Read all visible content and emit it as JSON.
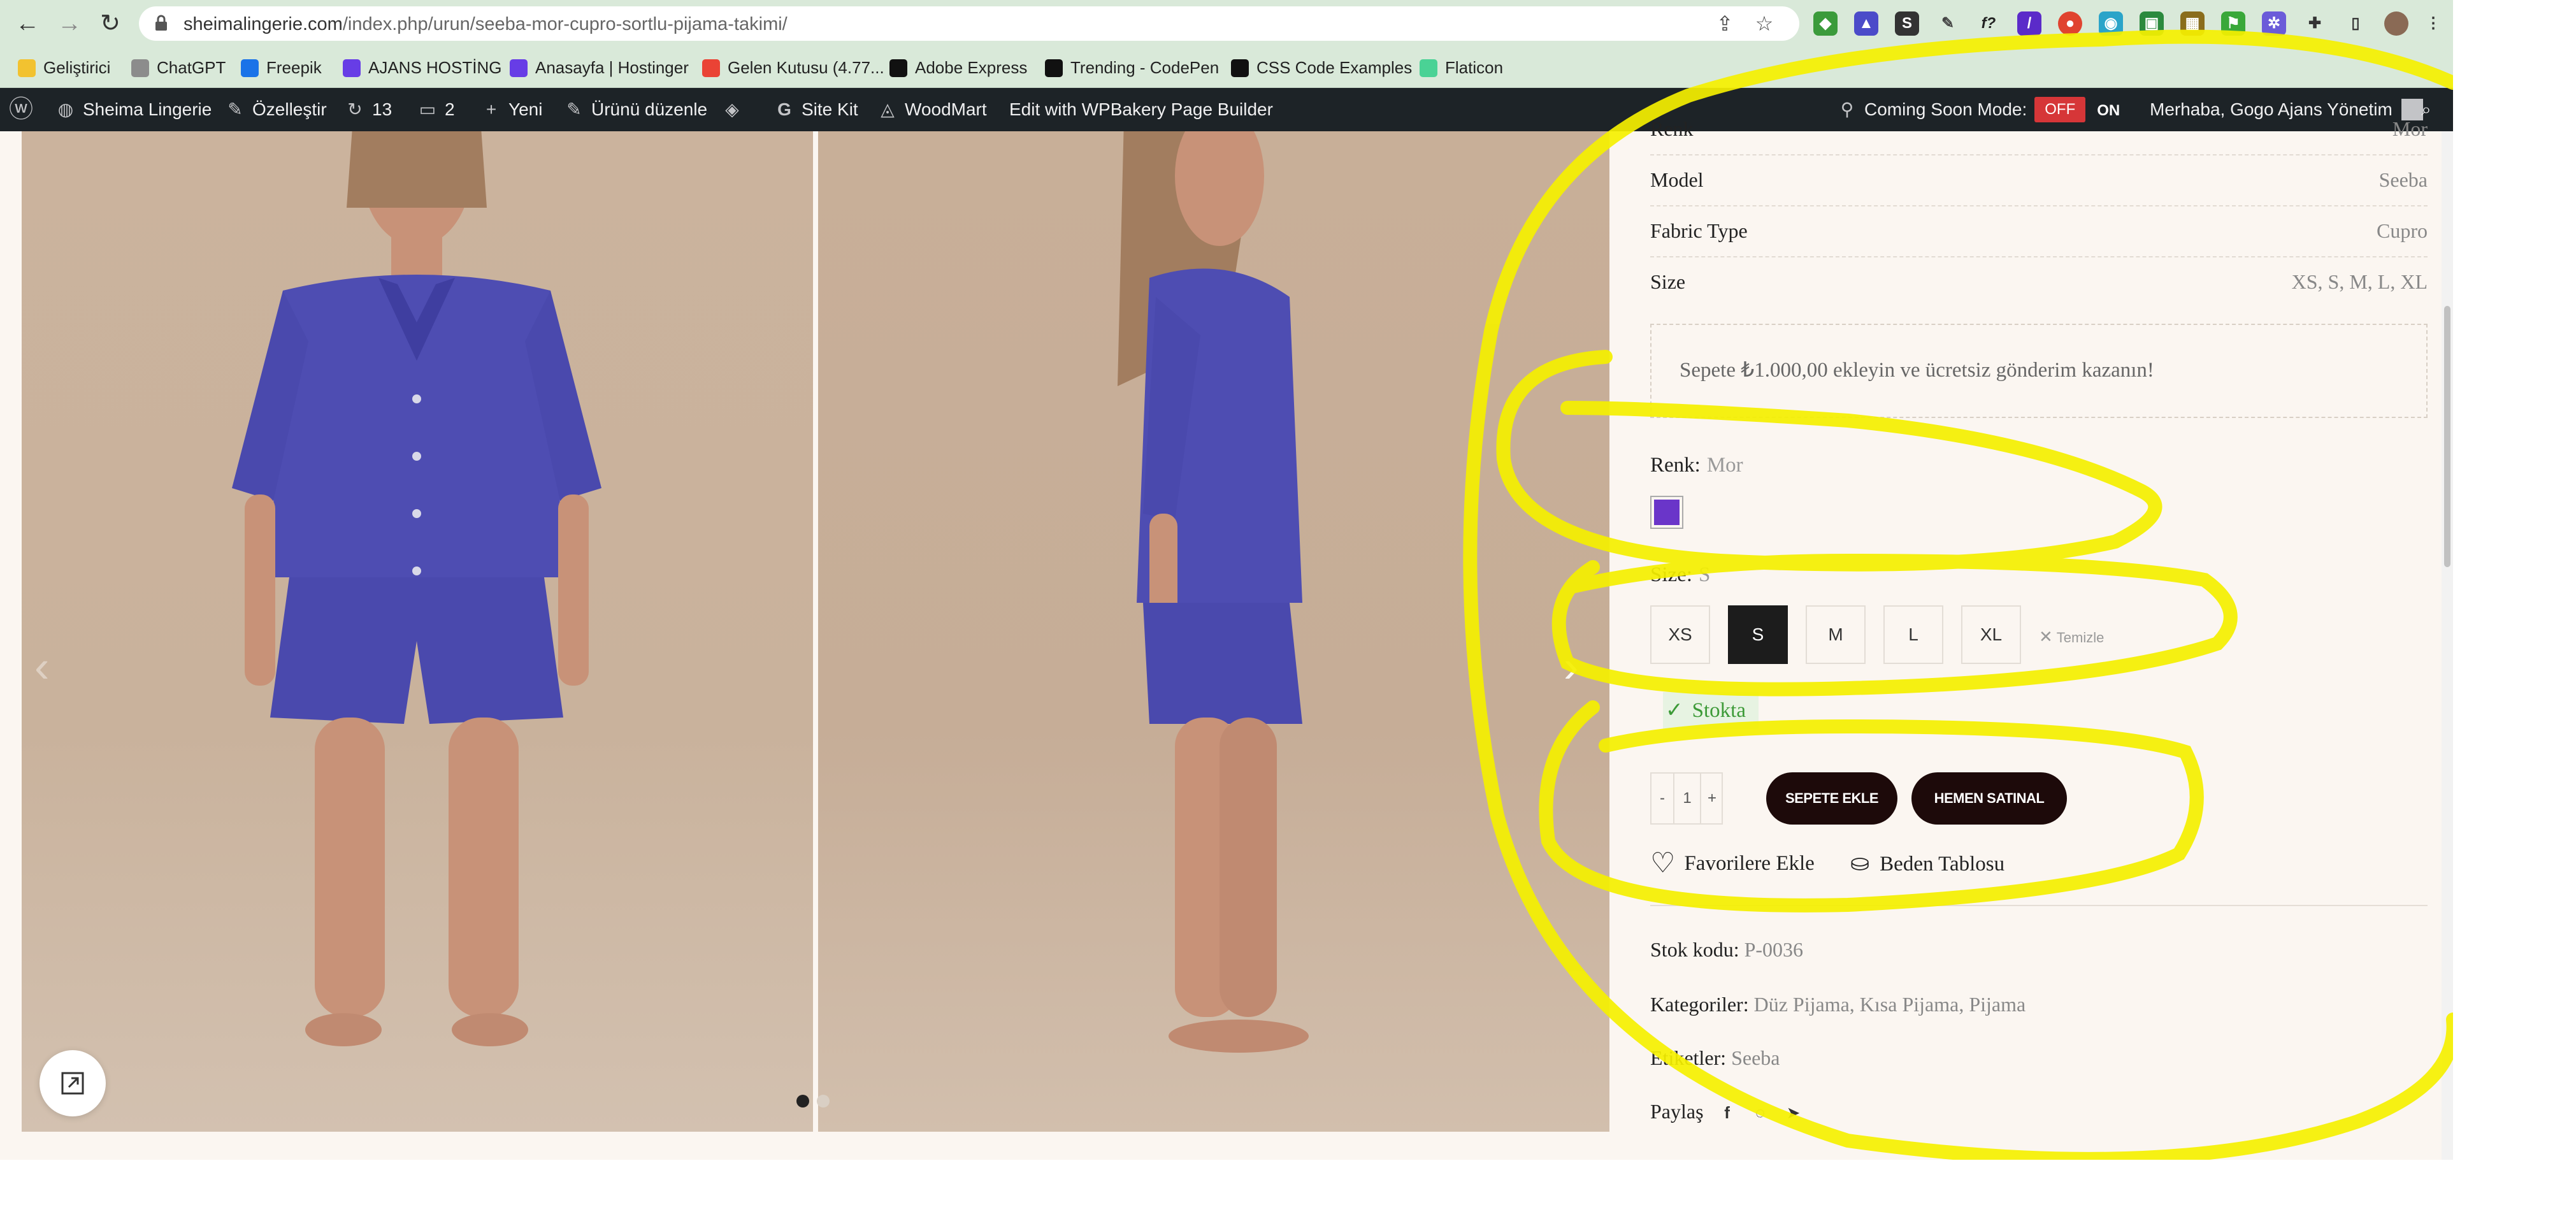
{
  "browser": {
    "url_host": "sheimalingerie.com",
    "url_path": "/index.php/urun/seeba-mor-cupro-sortlu-pijama-takimi/",
    "bookmarks": [
      {
        "label": "Geliştirici",
        "color": "#f2c230"
      },
      {
        "label": "ChatGPT",
        "color": "#8c8c8c"
      },
      {
        "label": "Freepik",
        "color": "#1a73e8"
      },
      {
        "label": "AJANS HOSTİNG",
        "color": "#673de6"
      },
      {
        "label": "Anasayfa | Hostinger",
        "color": "#673de6"
      },
      {
        "label": "Gelen Kutusu (4.77...",
        "color": "#ea4335"
      },
      {
        "label": "Adobe Express",
        "color": "#111111"
      },
      {
        "label": "Trending - CodePen",
        "color": "#111111"
      },
      {
        "label": "CSS Code Examples",
        "color": "#111111"
      },
      {
        "label": "Flaticon",
        "color": "#4ad295"
      }
    ]
  },
  "adminbar": {
    "site": "Sheima Lingerie",
    "customize": "Özelleştir",
    "updates": "13",
    "comments": "2",
    "new": "Yeni",
    "edit": "Ürünü düzenle",
    "sitekit": "Site Kit",
    "woodmart": "WoodMart",
    "wpbakery": "Edit with WPBakery Page Builder",
    "coming_soon": "Coming Soon Mode:",
    "off": "OFF",
    "on": "ON",
    "greeting": "Merhaba, Gogo Ajans Yönetim"
  },
  "product": {
    "attributes": [
      {
        "key": "Renk",
        "value": "Mor"
      },
      {
        "key": "Model",
        "value": "Seeba"
      },
      {
        "key": "Fabric Type",
        "value": "Cupro"
      },
      {
        "key": "Size",
        "value": "XS, S, M, L, XL"
      }
    ],
    "shipping_notice": "Sepete ₺1.000,00 ekleyin ve ücretsiz gönderim kazanın!",
    "color_label": "Renk:",
    "color_selected": "Mor",
    "color_swatch": "#6a35c9",
    "size_label": "Size:",
    "size_selected": "S",
    "sizes": [
      "XS",
      "S",
      "M",
      "L",
      "XL"
    ],
    "clear_label": "Temizle",
    "stock": "Stokta",
    "qty_minus": "-",
    "qty_value": "1",
    "qty_plus": "+",
    "add_to_cart": "SEPETE EKLE",
    "buy_now": "HEMEN SATINAL",
    "wishlist": "Favorilere Ekle",
    "size_chart": "Beden Tablosu",
    "sku_label": "Stok kodu:",
    "sku": "P-0036",
    "categories_label": "Kategoriler:",
    "categories": "Düz Pijama, Kısa Pijama, Pijama",
    "tags_label": "Etiketler:",
    "tags": "Seeba",
    "share_label": "Paylaş"
  }
}
